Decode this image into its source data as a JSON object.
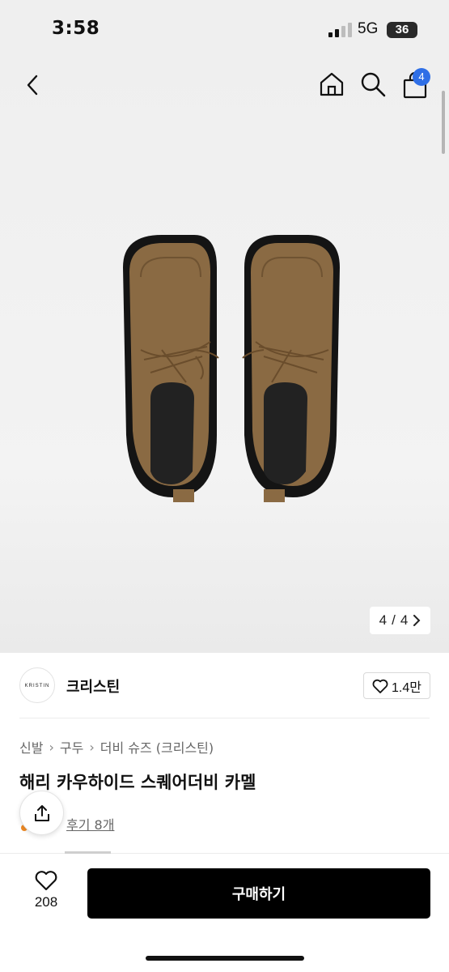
{
  "status_bar": {
    "time": "3:58",
    "network": "5G",
    "battery": "36"
  },
  "header": {
    "cart_count": "4"
  },
  "gallery": {
    "page_current": "4",
    "page_sep": "/",
    "page_total": "4",
    "next_icon": "chevron-right-icon"
  },
  "brand": {
    "logo_text": "KRISTIN",
    "name": "크리스틴",
    "likes": "1.4만"
  },
  "breadcrumb": [
    "신발",
    "구두",
    "더비 슈즈 (크리스틴)"
  ],
  "product": {
    "title": "해리 카우하이드 스퀘어더비 카멜",
    "reviews": "후기 8개"
  },
  "bottom": {
    "wish_count": "208",
    "buy_label": "구매하기"
  },
  "colors": {
    "accent_badge": "#2f6fe6",
    "buy_button": "#000000",
    "shoe_suede": "#8a6a43"
  }
}
